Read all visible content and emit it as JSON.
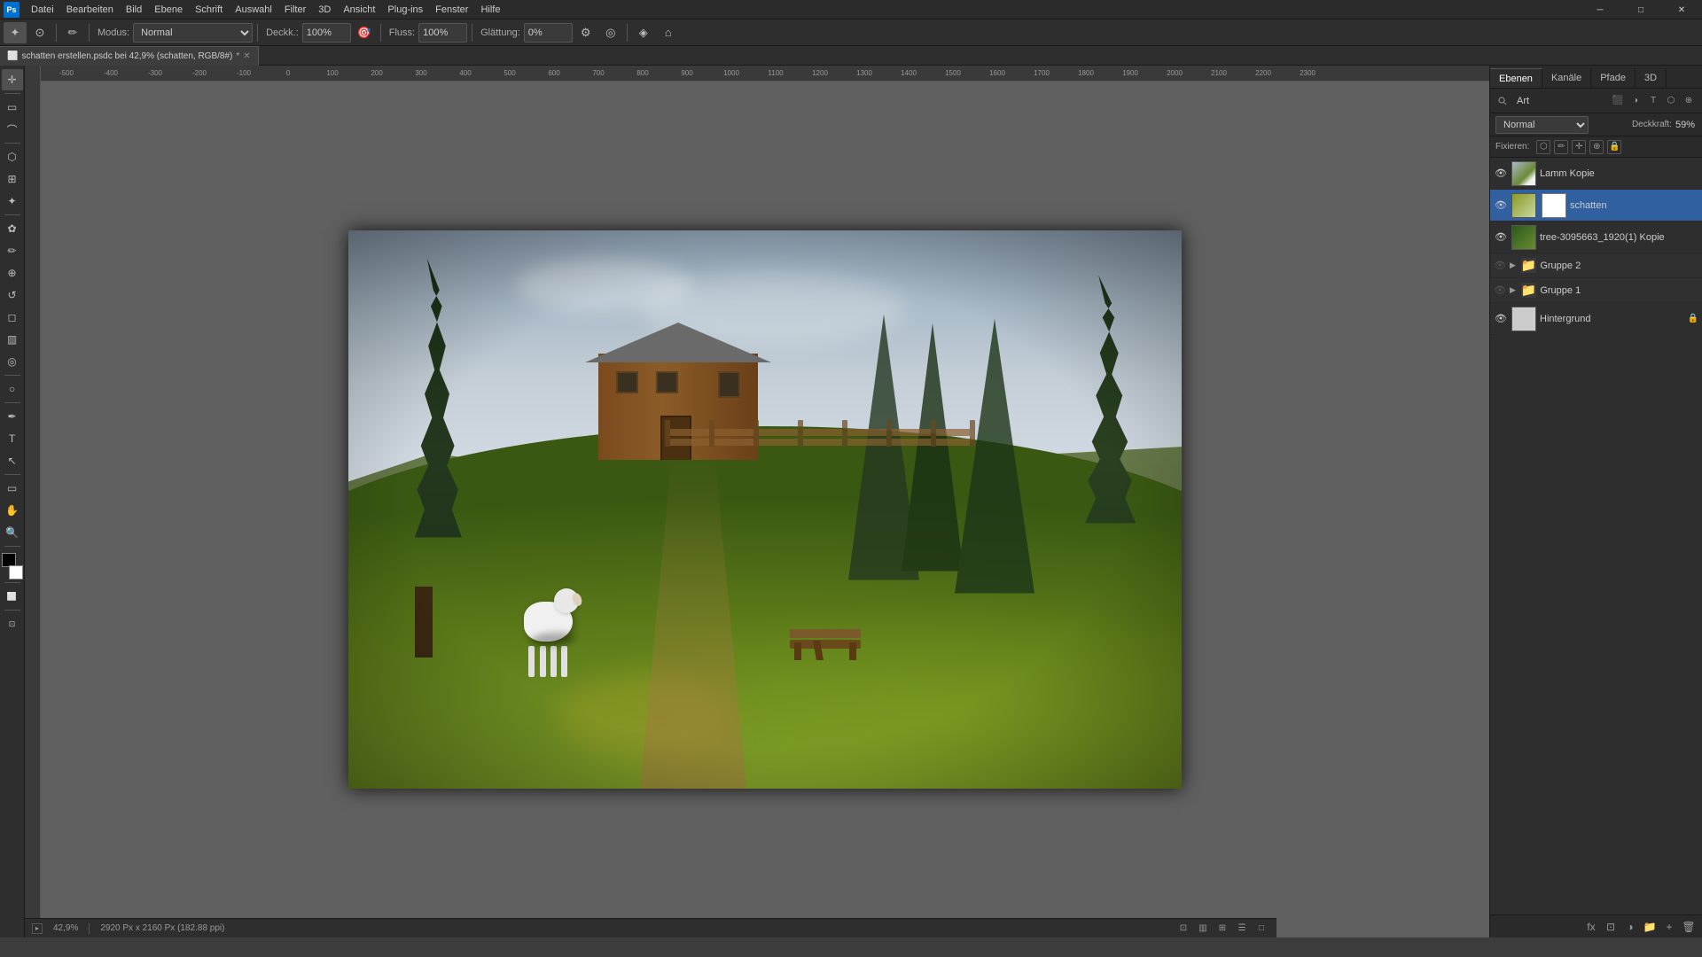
{
  "app": {
    "title": "Adobe Photoshop",
    "version": "PS"
  },
  "menu": {
    "items": [
      "Datei",
      "Bearbeiten",
      "Bild",
      "Ebene",
      "Schrift",
      "Auswahl",
      "Filter",
      "3D",
      "Ansicht",
      "Plug-ins",
      "Fenster",
      "Hilfe"
    ]
  },
  "window_controls": {
    "minimize": "─",
    "maximize": "□",
    "close": "✕"
  },
  "toolbar": {
    "modus_label": "Modus:",
    "modus_value": "Normal",
    "deckkraft_label": "Deckk.:",
    "deckkraft_value": "100%",
    "fluss_label": "Fluss:",
    "fluss_value": "100%",
    "glaettung_label": "Glättung:",
    "glaettung_value": "0%"
  },
  "file_tab": {
    "name": "schatten erstellen.psdc bei 42,9% (schatten, RGB/8#)",
    "modified": true
  },
  "canvas": {
    "zoom": "42,9%",
    "dimensions": "2920 Px x 2160 Px (182.88 ppi)"
  },
  "ruler": {
    "top_marks": [
      "-500",
      "-400",
      "-300",
      "-200",
      "-100",
      "0",
      "100",
      "200",
      "300",
      "400",
      "500",
      "600",
      "700",
      "800",
      "900",
      "1000",
      "1100",
      "1200",
      "1300",
      "1400",
      "1500",
      "1600",
      "1700",
      "1800",
      "1900",
      "2000",
      "2100",
      "2200",
      "2300"
    ]
  },
  "right_panel": {
    "tabs": [
      "Ebenen",
      "Kanäle",
      "Pfade",
      "3D"
    ],
    "active_tab": "Ebenen"
  },
  "layers_panel": {
    "search_type": "Art",
    "blend_mode": "Normal",
    "opacity_label": "Deckkraft:",
    "opacity_value": "59%",
    "lock_label": "Fixieren:",
    "fill_label": "",
    "layers": [
      {
        "id": "lamm-kopie",
        "name": "Lamm Kopie",
        "visible": true,
        "type": "photo",
        "selected": false,
        "indent": 0
      },
      {
        "id": "schatten",
        "name": "schatten",
        "visible": true,
        "type": "white",
        "selected": true,
        "indent": 0
      },
      {
        "id": "tree-kopie",
        "name": "tree-3095663_1920(1) Kopie",
        "visible": true,
        "type": "tree",
        "selected": false,
        "indent": 0
      },
      {
        "id": "gruppe-2",
        "name": "Gruppe 2",
        "visible": false,
        "type": "folder",
        "selected": false,
        "indent": 0,
        "isGroup": true
      },
      {
        "id": "gruppe-1",
        "name": "Gruppe 1",
        "visible": false,
        "type": "folder",
        "selected": false,
        "indent": 0,
        "isGroup": true
      },
      {
        "id": "hintergrund",
        "name": "Hintergrund",
        "visible": true,
        "type": "gray",
        "selected": false,
        "indent": 0,
        "locked": true
      }
    ]
  },
  "status_bar": {
    "zoom": "42,9%",
    "dimensions": "2920 Px x 2160 Px (182.88 ppi)"
  }
}
